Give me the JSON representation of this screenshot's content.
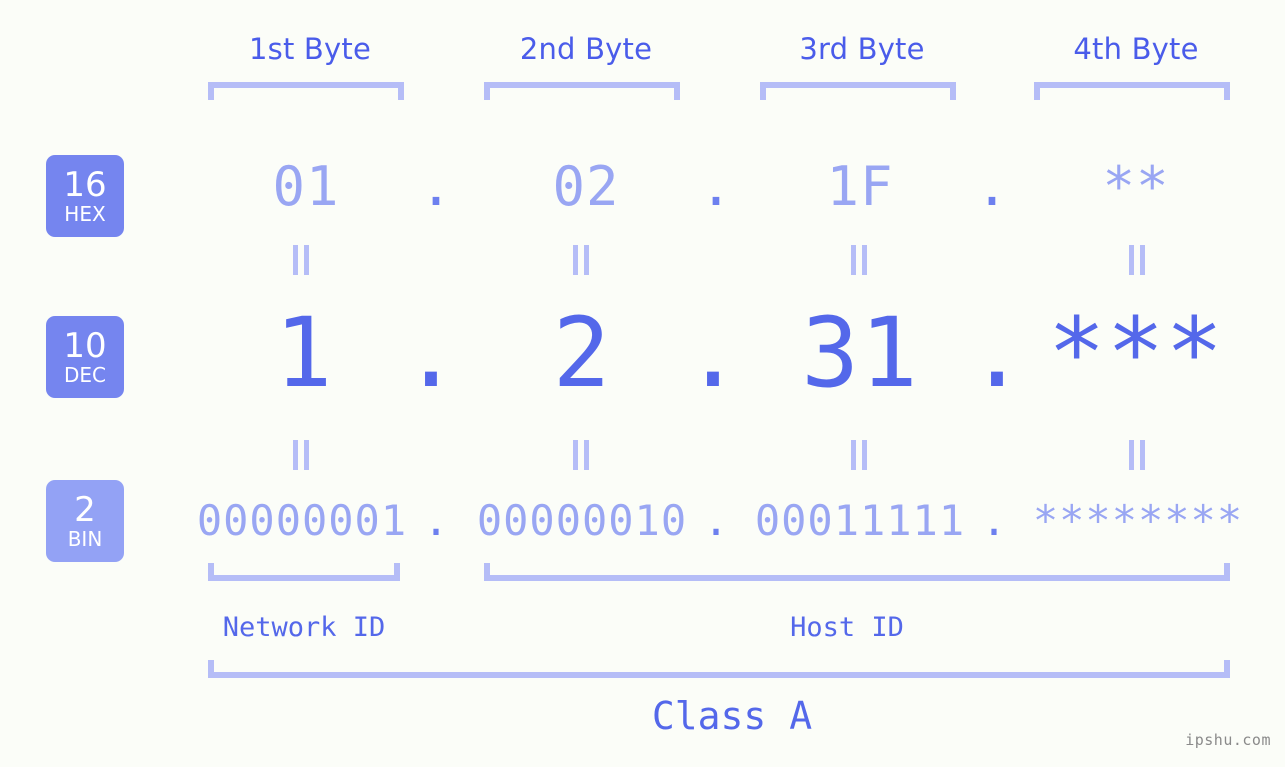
{
  "meta": {
    "background": "#fbfdf8",
    "accent_dark": "#4a5cea",
    "accent_mid": "#5468ea",
    "accent_light": "#99a6f3",
    "accent_pale": "#b5bdf7",
    "badge_fill_dark": "#7585ef",
    "badge_fill_light": "#93a2f5",
    "watermark_color": "#8a8a8a"
  },
  "header": {
    "bytes": [
      {
        "label": "1st Byte"
      },
      {
        "label": "2nd Byte"
      },
      {
        "label": "3rd Byte"
      },
      {
        "label": "4th Byte"
      }
    ]
  },
  "bases": [
    {
      "number": "16",
      "name": "HEX"
    },
    {
      "number": "10",
      "name": "DEC"
    },
    {
      "number": "2",
      "name": "BIN"
    }
  ],
  "rows": {
    "hex": {
      "values": [
        "01",
        "02",
        "1F",
        "**"
      ],
      "separators": [
        ".",
        ".",
        "."
      ]
    },
    "dec": {
      "values": [
        "1",
        "2",
        "31",
        "***"
      ],
      "separators": [
        ".",
        ".",
        "."
      ]
    },
    "bin": {
      "values": [
        "00000001",
        "00000010",
        "00011111",
        "********"
      ],
      "separators": [
        ".",
        ".",
        "."
      ]
    }
  },
  "equals_marks": {
    "glyph": "||",
    "count_per_row": 4
  },
  "footer": {
    "network_id_label": "Network ID",
    "host_id_label": "Host ID",
    "class_label": "Class A"
  },
  "watermark": {
    "text": "ipshu.com"
  }
}
